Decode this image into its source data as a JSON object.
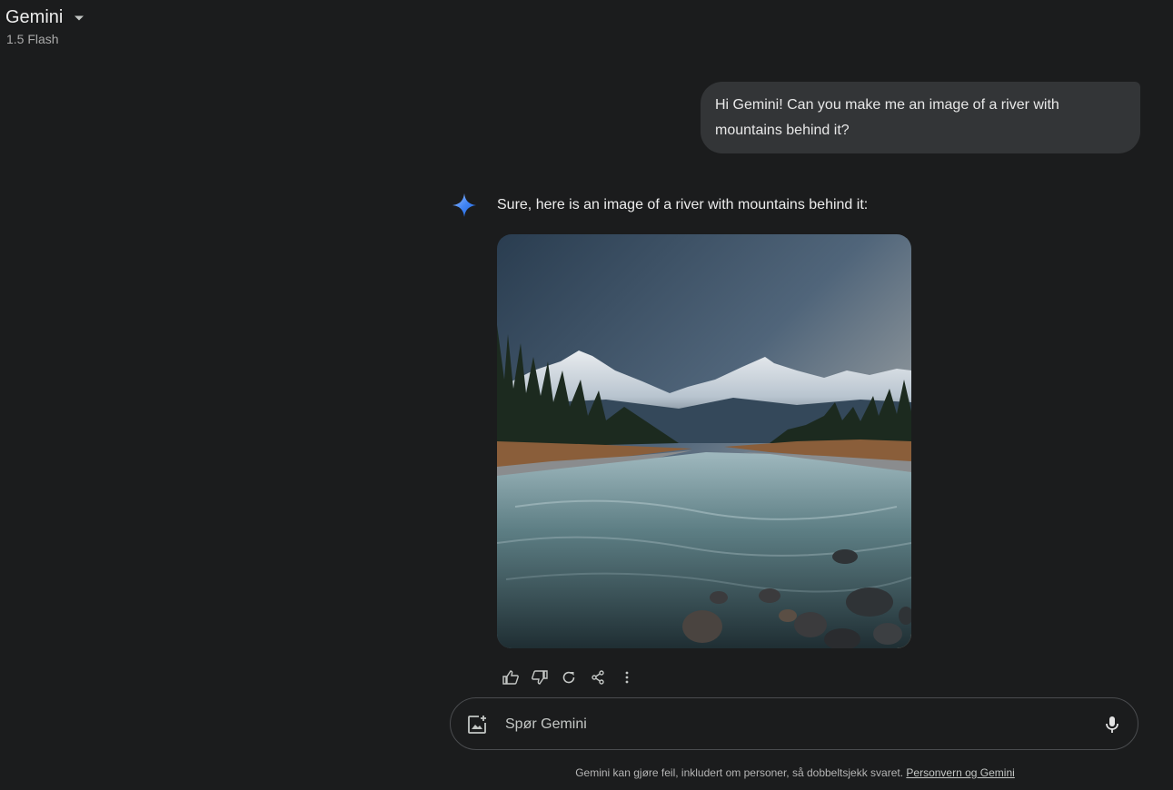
{
  "header": {
    "title": "Gemini",
    "model": "1.5 Flash"
  },
  "conversation": {
    "user_message": "Hi Gemini! Can you make me an image of a river with mountains behind it?",
    "assistant_reply": "Sure, here is an image of a river with mountains behind it:"
  },
  "input": {
    "placeholder": "Spør Gemini",
    "value": ""
  },
  "footer": {
    "disclaimer": "Gemini kan gjøre feil, inkludert om personer, så dobbeltsjekk svaret.",
    "link": "Personvern og Gemini"
  },
  "icons": {
    "dropdown": "caret-down-icon",
    "assistant": "gemini-spark-icon",
    "like": "thumbs-up-icon",
    "dislike": "thumbs-down-icon",
    "regenerate": "refresh-icon",
    "share": "share-icon",
    "more": "more-vertical-icon",
    "upload": "add-image-icon",
    "mic": "microphone-icon"
  },
  "colors": {
    "background": "#1b1c1d",
    "user_bubble": "#333537",
    "spark_accent": "#4285f4"
  }
}
